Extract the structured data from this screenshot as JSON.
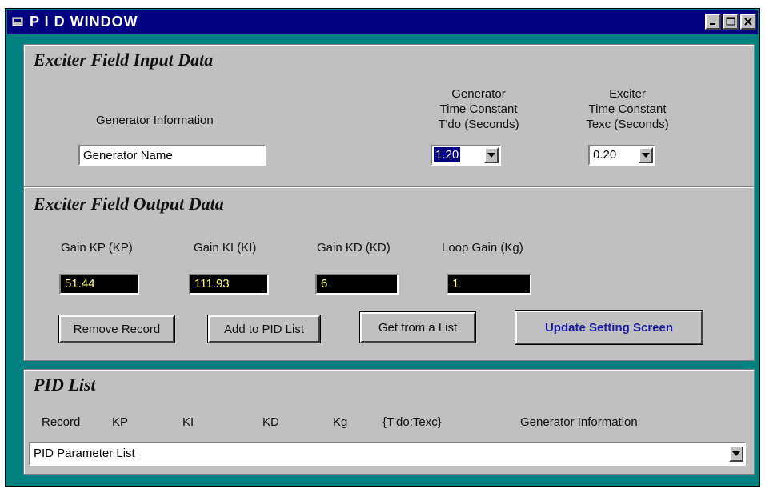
{
  "window": {
    "title": "P I D WINDOW",
    "icons": [
      "app-icon",
      "minimize-icon",
      "maximize-icon",
      "close-icon"
    ]
  },
  "input_panel": {
    "title": "Exciter Field Input Data",
    "generator_info_label": "Generator Information",
    "generator_name_value": "Generator Name",
    "gen_tc_label_1": "Generator",
    "gen_tc_label_2": "Time Constant",
    "gen_tc_label_3": "T'do (Seconds)",
    "gen_tc_value": "1.20",
    "exc_tc_label_1": "Exciter",
    "exc_tc_label_2": "Time Constant",
    "exc_tc_label_3": "Texc (Seconds)",
    "exc_tc_value": "0.20"
  },
  "output_panel": {
    "title": "Exciter Field Output Data",
    "kp_label": "Gain KP (KP)",
    "kp_value": "51.44",
    "ki_label": "Gain KI (KI)",
    "ki_value": "111.93",
    "kd_label": "Gain KD (KD)",
    "kd_value": "6",
    "kg_label": "Loop Gain (Kg)",
    "kg_value": "1",
    "remove_button": "Remove Record",
    "add_button": "Add to PID List",
    "get_button": "Get from a List",
    "update_button": "Update Setting Screen"
  },
  "list_panel": {
    "title": "PID List",
    "headers": [
      "Record",
      "KP",
      "KI",
      "KD",
      "Kg",
      "{T'do:Texc}",
      "Generator Information"
    ],
    "combo_value": "PID Parameter List"
  },
  "colors": {
    "background": "#008080",
    "titlebar": "#000080",
    "panel": "#c0c0c0",
    "lcd_text": "#ffff80",
    "update_button_text": "#1a1aa0"
  }
}
